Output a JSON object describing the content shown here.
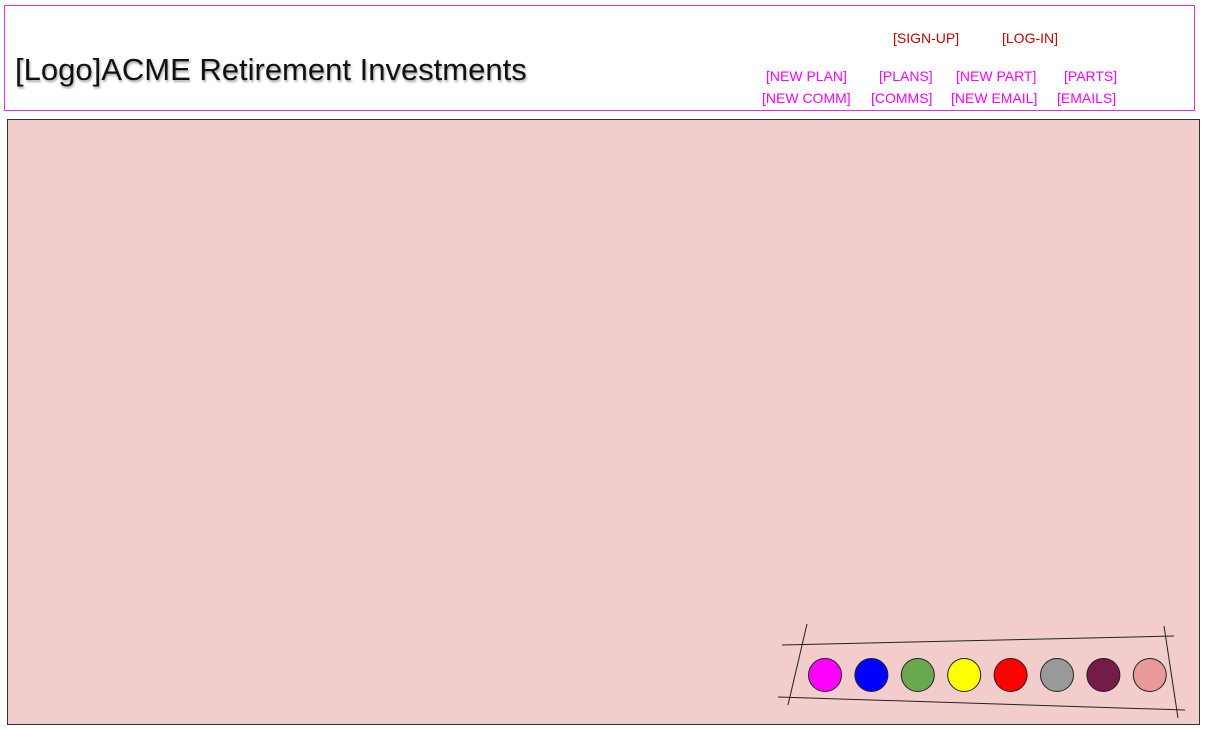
{
  "header": {
    "brand": "[Logo]ACME Retirement Investments",
    "auth": {
      "signup_label": "[SIGN-UP]",
      "login_label": "[LOG-IN]"
    },
    "nav": {
      "new_plan": "[NEW PLAN]",
      "plans": "[PLANS]",
      "new_part": "[NEW PART]",
      "parts": "[PARTS]",
      "new_comm": "[NEW COMM]",
      "comms": "[COMMS]",
      "new_email": "[NEW EMAIL]",
      "emails": "[EMAILS]"
    }
  },
  "colors": {
    "header_border": "#e62de6",
    "auth_link": "#cc0000",
    "nav_link": "#ff00ff",
    "main_background": "#f3cccc"
  },
  "palette": {
    "swatches": [
      {
        "name": "magenta",
        "color": "#ff00ff"
      },
      {
        "name": "blue",
        "color": "#0000ff"
      },
      {
        "name": "green",
        "color": "#6aa84f"
      },
      {
        "name": "yellow",
        "color": "#ffff00"
      },
      {
        "name": "red",
        "color": "#ff0000"
      },
      {
        "name": "gray",
        "color": "#999999"
      },
      {
        "name": "plum",
        "color": "#741b47"
      },
      {
        "name": "rose",
        "color": "#ea9999"
      }
    ]
  }
}
